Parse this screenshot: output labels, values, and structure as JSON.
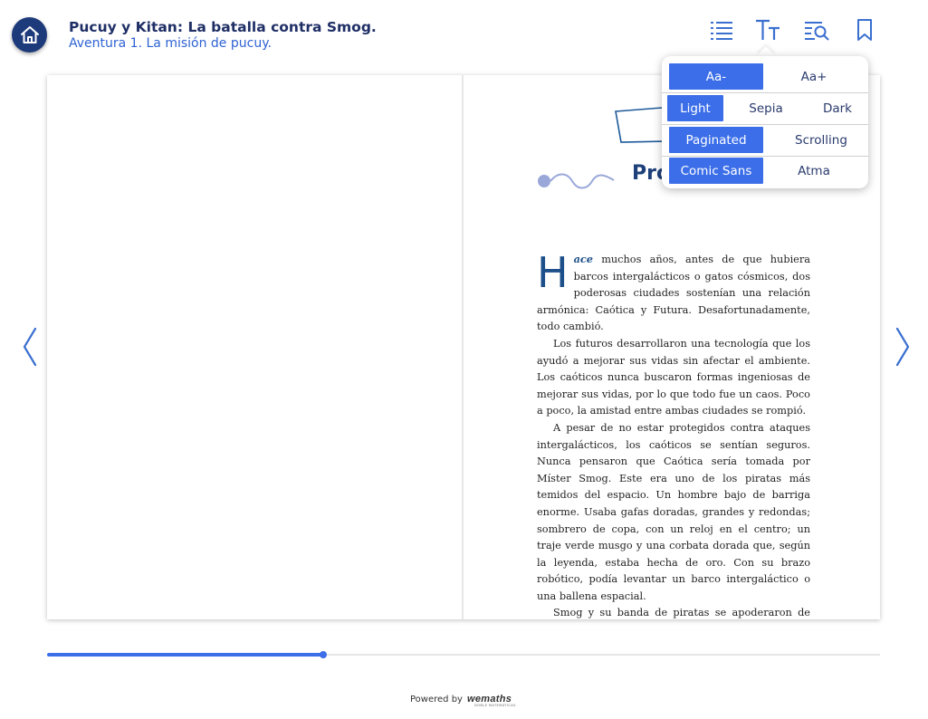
{
  "header": {
    "title": "Pucuy y Kitan: La batalla contra Smog.",
    "subtitle": "Aventura 1.  La misión de pucuy."
  },
  "icons": {
    "home": "home-icon",
    "toc": "list-icon",
    "font_settings": "text-size-icon",
    "search": "search-icon",
    "bookmark": "bookmark-icon",
    "prev": "chevron-left-icon",
    "next": "chevron-right-icon"
  },
  "settings_popover": {
    "font_size": {
      "decrease": "Aa-",
      "increase": "Aa+"
    },
    "theme": {
      "options": [
        "Light",
        "Sepia",
        "Dark"
      ],
      "selected": "Light"
    },
    "layout": {
      "options": [
        "Paginated",
        "Scrolling"
      ],
      "selected": "Paginated"
    },
    "font": {
      "options": [
        "Comic Sans",
        "Atma"
      ],
      "selected": "Comic Sans"
    }
  },
  "book": {
    "chapter_title_visible": "Pró",
    "dropcap": "H",
    "lead": "ace",
    "paragraph1_rest": " muchos años, antes de que hubiera barcos intergalácticos o gatos cósmicos, dos poderosas ciudades sostenían una relación armónica: Caótica y Futura. Desafortunadamente, todo cambió.",
    "paragraph2": "Los futuros desarrollaron una tecnología que los ayudó a mejorar sus vidas sin afectar el ambiente. Los caóticos nunca buscaron formas ingeniosas de mejorar sus vidas, por lo que todo fue un caos. Poco a poco, la amistad entre ambas ciudades se rompió.",
    "paragraph3": "A pesar de no estar protegidos contra ataques intergalácticos, los caóticos se sentían seguros. Nunca pensaron que Caótica sería tomada por Míster Smog. Este era uno de los piratas más temidos del espacio. Un hombre bajo de barriga enorme. Usaba gafas doradas, grandes y redondas; sombrero de copa, con un reloj en el centro; un traje verde musgo y una corbata dorada que, según la leyenda, estaba hecha de oro. Con su brazo robótico, podía levantar un barco intergaláctico o una ballena espacial.",
    "paragraph4": "Smog y su banda de piratas se apoderaron de Caótica, pero su dominio pronto llegaría a su fin."
  },
  "progress": {
    "fraction": 0.332
  },
  "footer": {
    "powered_by": "Powered by",
    "brand": "wemaths",
    "brand_tagline": "DOBLE MATEMÁTICAS"
  },
  "colors": {
    "accent": "#3b6ee8",
    "home_button": "#1d3a7a",
    "title": "#1f2f66",
    "subtitle": "#2e62d3"
  }
}
